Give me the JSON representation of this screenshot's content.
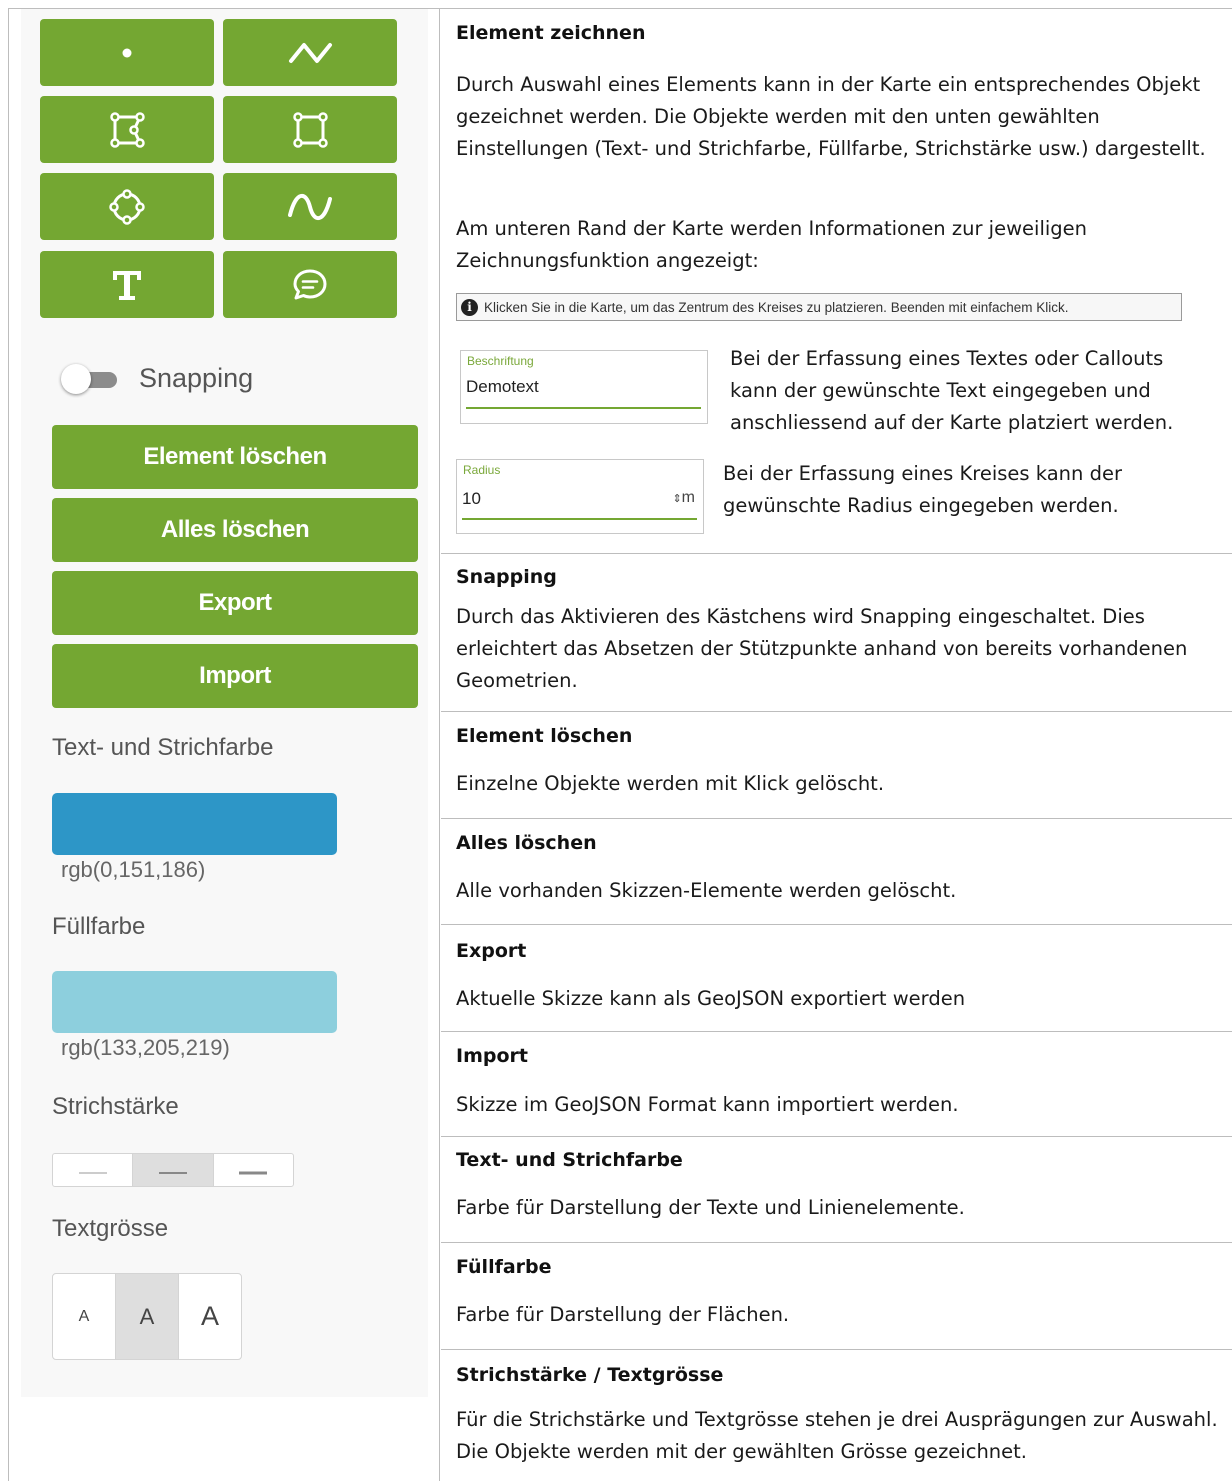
{
  "panel": {
    "tools": [
      {
        "name": "point-tool",
        "icon": "point-icon"
      },
      {
        "name": "line-tool",
        "icon": "polyline-icon"
      },
      {
        "name": "polygon-tool",
        "icon": "polygon-icon"
      },
      {
        "name": "rectangle-tool",
        "icon": "rectangle-icon"
      },
      {
        "name": "circle-tool",
        "icon": "circle-icon"
      },
      {
        "name": "freehand-tool",
        "icon": "freehand-curve-icon"
      },
      {
        "name": "text-tool",
        "icon": "text-icon"
      },
      {
        "name": "callout-tool",
        "icon": "speech-bubble-icon"
      }
    ],
    "snapping_label": "Snapping",
    "snapping_on": false,
    "buttons": {
      "delete_element": "Element löschen",
      "delete_all": "Alles löschen",
      "export": "Export",
      "import": "Import"
    },
    "stroke_color_label": "Text- und Strichfarbe",
    "stroke_color_value": "rgb(0,151,186)",
    "stroke_color_hex": "#2d96c7",
    "fill_color_label": "Füllfarbe",
    "fill_color_value": "rgb(133,205,219)",
    "fill_color_hex": "#8dcfdd",
    "stroke_width_label": "Strichstärke",
    "stroke_width_options": [
      "thin",
      "medium",
      "thick"
    ],
    "stroke_width_selected": "medium",
    "text_size_label": "Textgrösse",
    "text_size_options": [
      "A",
      "A",
      "A"
    ],
    "text_size_selected": 1,
    "accent_color": "#74a732"
  },
  "sections": {
    "draw": {
      "title": "Element zeichnen",
      "p1": "Durch Auswahl eines Elements kann in der Karte ein entsprechendes Objekt gezeichnet werden. Die Objekte werden mit den unten gewählten Einstellungen (Text- und Strichfarbe, Füllfarbe, Strichstärke usw.) dargestellt.",
      "p2": "Am unteren Rand der Karte werden Informationen zur jeweiligen Zeichnungsfunktion angezeigt:",
      "info_bar_text": "Klicken Sie in die Karte, um das Zentrum des Kreises zu platzieren. Beenden mit einfachem Klick.",
      "label_field_label": "Beschriftung",
      "label_field_value": "Demotext",
      "label_text": "Bei der Erfassung eines Textes oder Callouts kann der gewünschte Text eingegeben und anschliessend auf der Karte platziert werden.",
      "radius_field_label": "Radius",
      "radius_field_value": "10",
      "radius_unit": "m",
      "radius_text": "Bei der Erfassung eines Kreises kann der gewünschte Radius eingegeben werden."
    },
    "snapping": {
      "title": "Snapping",
      "text": "Durch das Aktivieren des Kästchens wird Snapping eingeschaltet. Dies erleichtert das Absetzen der Stützpunkte anhand von bereits vorhandenen Geometrien."
    },
    "delete_element": {
      "title": "Element löschen",
      "text": "Einzelne Objekte werden mit Klick gelöscht."
    },
    "delete_all": {
      "title": "Alles löschen",
      "text": "Alle vorhanden Skizzen-Elemente werden gelöscht."
    },
    "export": {
      "title": "Export",
      "text": "Aktuelle Skizze kann als GeoJSON exportiert werden"
    },
    "import": {
      "title": "Import",
      "text": "Skizze im GeoJSON Format kann importiert werden."
    },
    "stroke_color": {
      "title": "Text- und Strichfarbe",
      "text": "Farbe für Darstellung der Texte und Linienelemente."
    },
    "fill_color": {
      "title": "Füllfarbe",
      "text": "Farbe für Darstellung der Flächen."
    },
    "stroke_text_size": {
      "title": "Strichstärke / Textgrösse",
      "text": "Für die Strichstärke und Textgrösse stehen je drei Ausprägungen zur Auswahl. Die Objekte werden mit der gewählten Grösse gezeichnet."
    }
  }
}
